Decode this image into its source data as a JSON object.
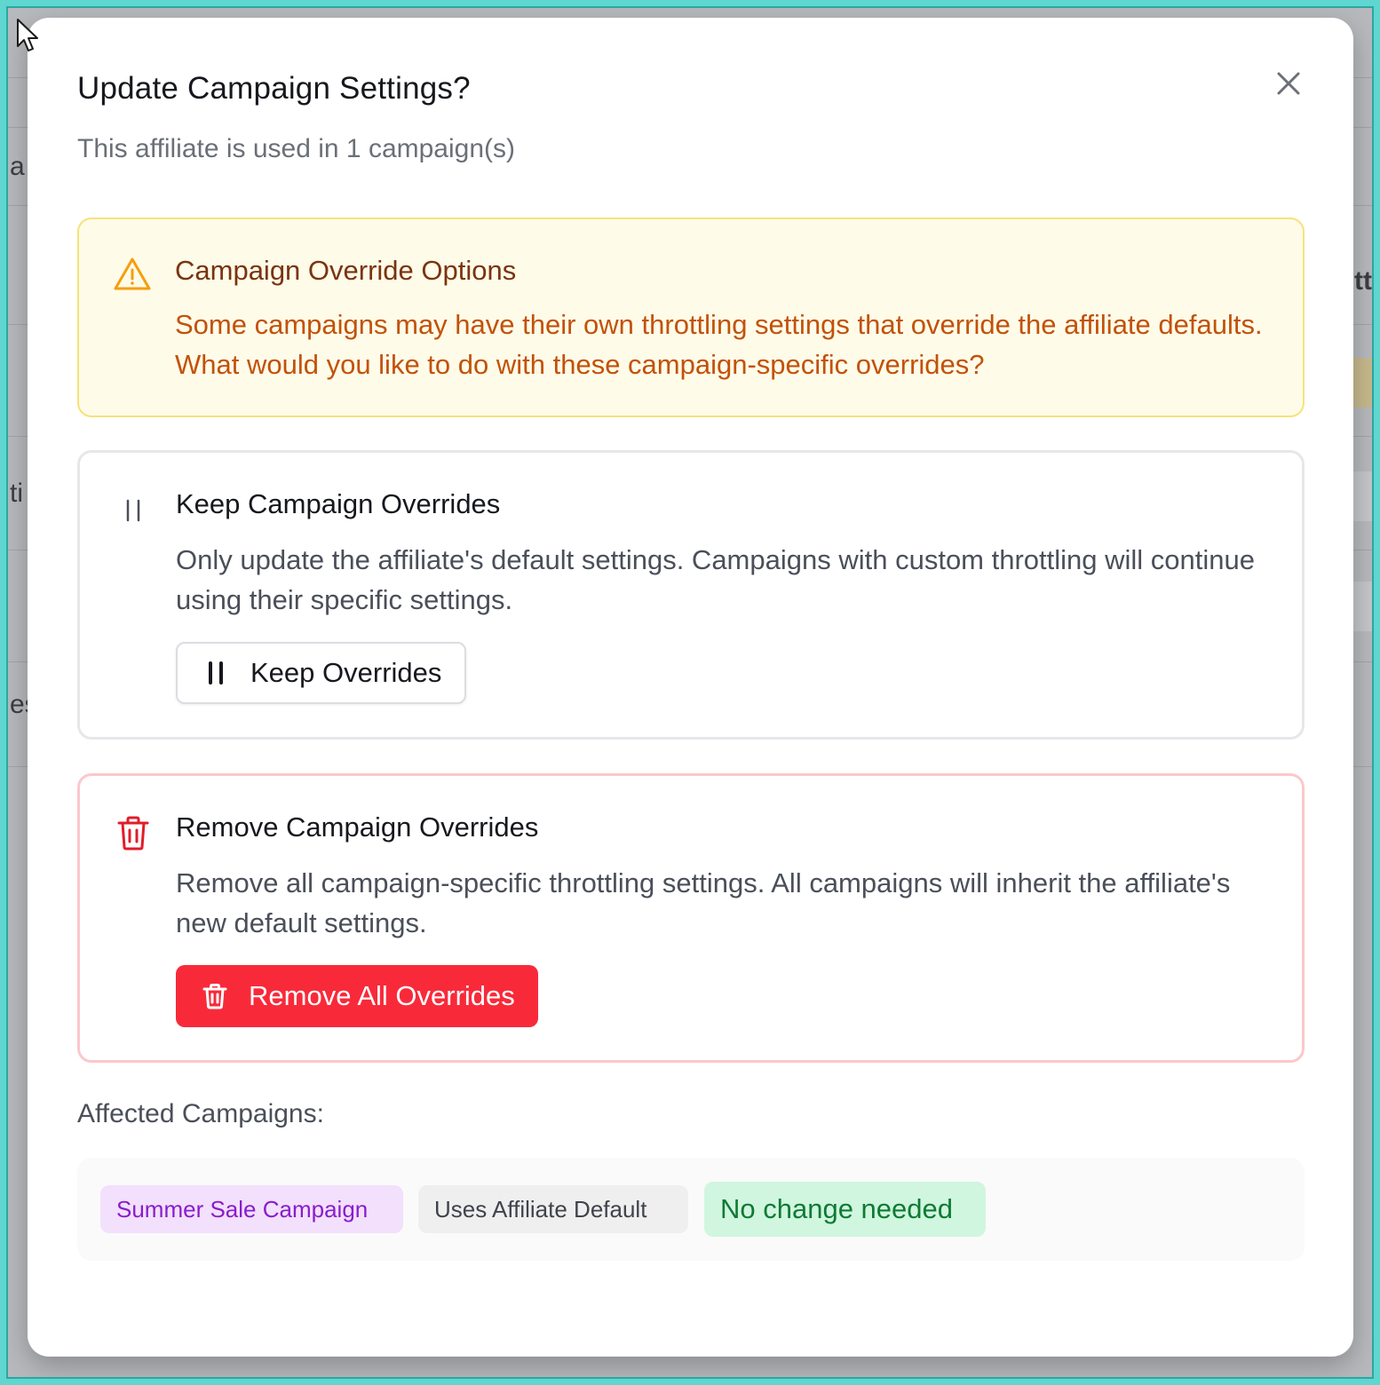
{
  "modal": {
    "title": "Update Campaign Settings?",
    "subtitle": "This affiliate is used in 1 campaign(s)",
    "close_icon": "close-icon"
  },
  "warning": {
    "icon": "warning-triangle-icon",
    "heading": "Campaign Override Options",
    "body": "Some campaigns may have their own throttling settings that override the affiliate defaults. What would you like to do with these campaign-specific overrides?",
    "colors": {
      "background": "#fefbe9",
      "border": "#f7e27a",
      "heading": "#7a3410",
      "text": "#c25208"
    }
  },
  "keep_option": {
    "icon": "pause-icon",
    "heading": "Keep Campaign Overrides",
    "body": "Only update the affiliate's default settings. Campaigns with custom throttling will continue using their specific settings.",
    "button_label": "Keep Overrides",
    "button_icon": "pause-icon"
  },
  "remove_option": {
    "icon": "trash-icon",
    "heading": "Remove Campaign Overrides",
    "body": "Remove all campaign-specific throttling settings. All campaigns will inherit the affiliate's new default settings.",
    "button_label": "Remove All Overrides",
    "button_icon": "trash-icon",
    "colors": {
      "accent": "#f82a3a",
      "border": "#fbc8cc"
    }
  },
  "affected": {
    "label": "Affected Campaigns:",
    "campaigns": [
      {
        "name": "Summer Sale Campaign",
        "setting": "Uses Affiliate Default",
        "status": "No change needed"
      }
    ],
    "colors": {
      "campaign_tag": "#f2e0fc",
      "default_tag": "#efeff0",
      "status_tag": "#d0f6df"
    }
  },
  "background_fragments": {
    "left_1": "a",
    "left_2": "ti",
    "left_3": "es",
    "right_1": "tt"
  }
}
